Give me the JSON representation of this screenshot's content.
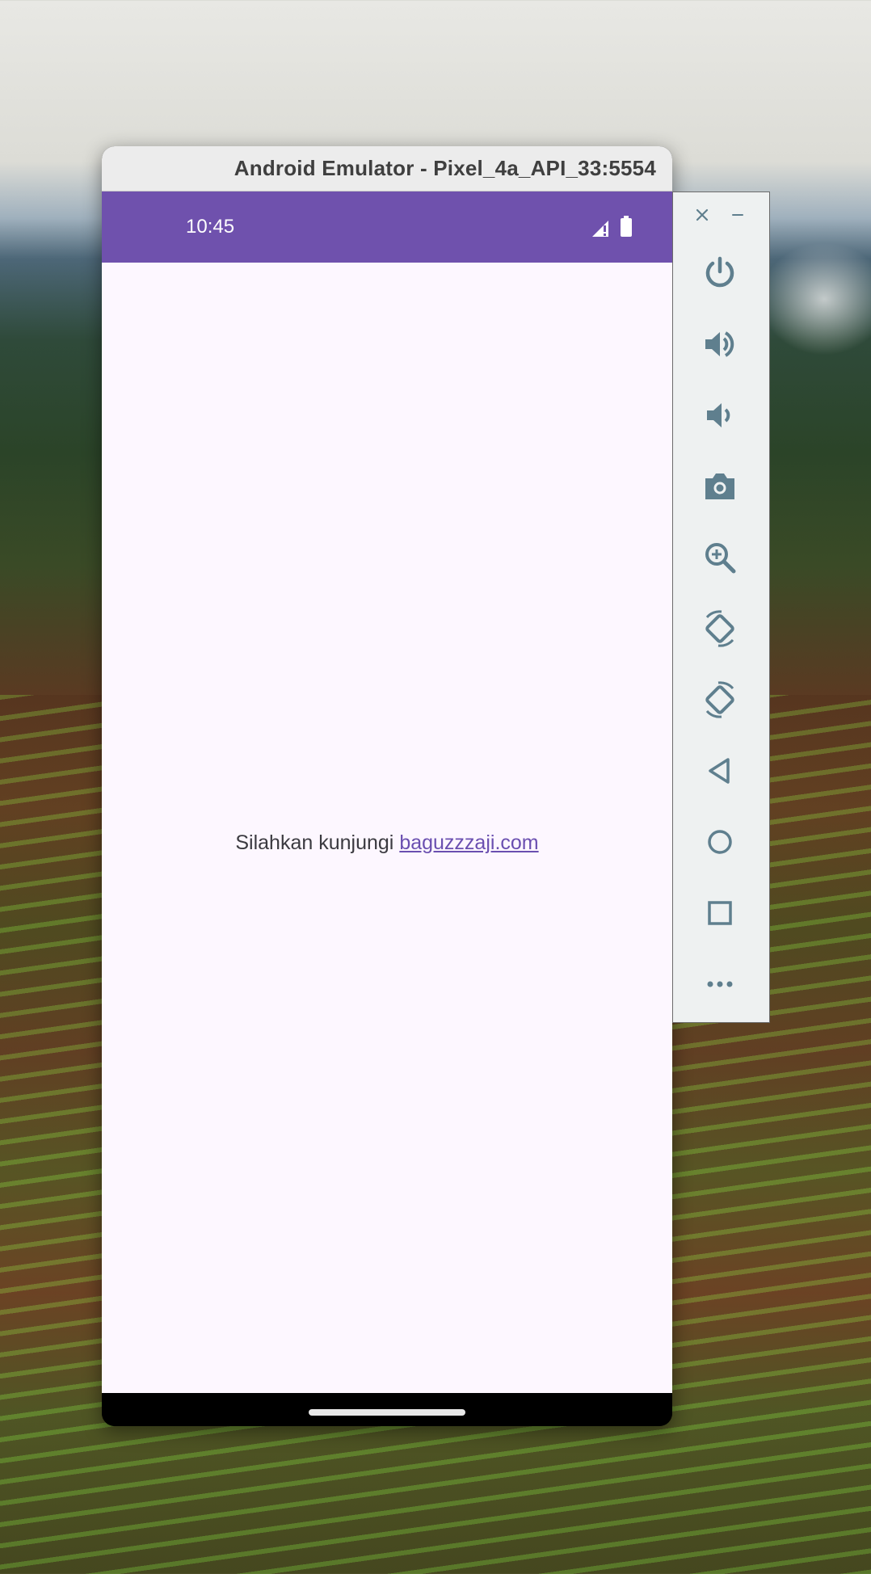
{
  "window": {
    "title": "Android Emulator - Pixel_4a_API_33:5554"
  },
  "status_bar": {
    "time": "10:45",
    "background": "#6f51ad",
    "icons": [
      "signal-icon",
      "battery-icon"
    ]
  },
  "app": {
    "message_prefix": "Silahkan kunjungi",
    "link_text": "baguzzzaji.com",
    "background": "#fdf7ff",
    "link_color": "#6a4fb0"
  },
  "toolbar": {
    "window_controls": [
      "close-icon",
      "minimize-icon"
    ],
    "buttons": [
      "power-icon",
      "volume-up-icon",
      "volume-down-icon",
      "camera-icon",
      "zoom-icon",
      "rotate-left-icon",
      "rotate-right-icon",
      "back-icon",
      "home-icon",
      "overview-icon",
      "more-icon"
    ],
    "icon_color": "#5f7f8e"
  }
}
